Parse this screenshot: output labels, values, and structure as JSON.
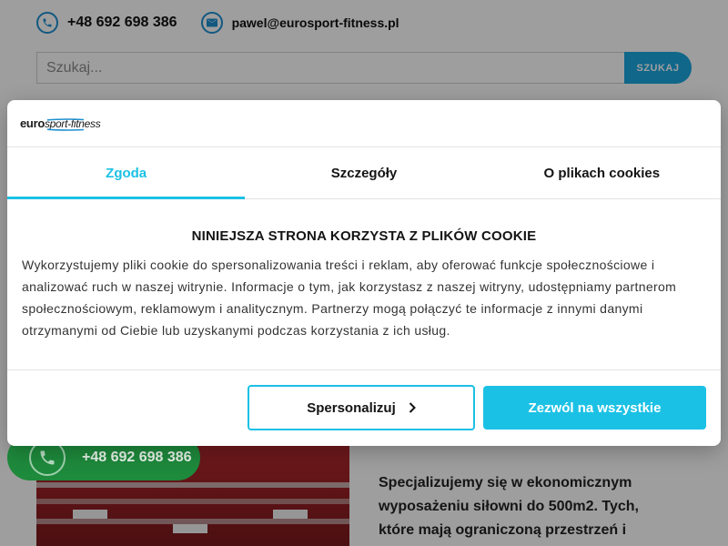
{
  "contact": {
    "phone": "+48 692 698 386",
    "email": "pawel@eurosport-fitness.pl",
    "phone_icon": "phone-icon",
    "email_icon": "mail-icon"
  },
  "search": {
    "placeholder": "Szukaj...",
    "button_label": "SZUKAJ"
  },
  "floating_phone": {
    "number": "+48 692 698 386",
    "icon": "phone-icon"
  },
  "content": {
    "intro_text": "Specjalizujemy się w ekonomicznym wyposażeniu siłowni do 500m2. Tych, które mają ograniczoną przestrzeń i"
  },
  "cookie_dialog": {
    "logo_bold": "euro",
    "logo_italic": "sport-fitness",
    "tabs": [
      {
        "label": "Zgoda",
        "active": true
      },
      {
        "label": "Szczegóły",
        "active": false
      },
      {
        "label": "O plikach cookies",
        "active": false
      }
    ],
    "title": "NINIEJSZA STRONA KORZYSTA Z PLIKÓW COOKIE",
    "text": "Wykorzystujemy pliki cookie do spersonalizowania treści i reklam, aby oferować funkcje społecznościowe i analizować ruch w naszej witrynie. Informacje o tym, jak korzystasz z naszej witryny, udostępniamy partnerom społecznościowym, reklamowym i analitycznym. Partnerzy mogą połączyć te informacje z innymi danymi otrzymanymi od Ciebie lub uzyskanymi podczas korzystania z ich usług.",
    "personalize_label": "Spersonalizuj",
    "allow_all_label": "Zezwól na wszystkie"
  },
  "colors": {
    "accent": "#1bc1e5",
    "contact_icon": "#1d8fd0",
    "search_button": "#1aa6df",
    "phone_pill": "#1e8a3c"
  }
}
